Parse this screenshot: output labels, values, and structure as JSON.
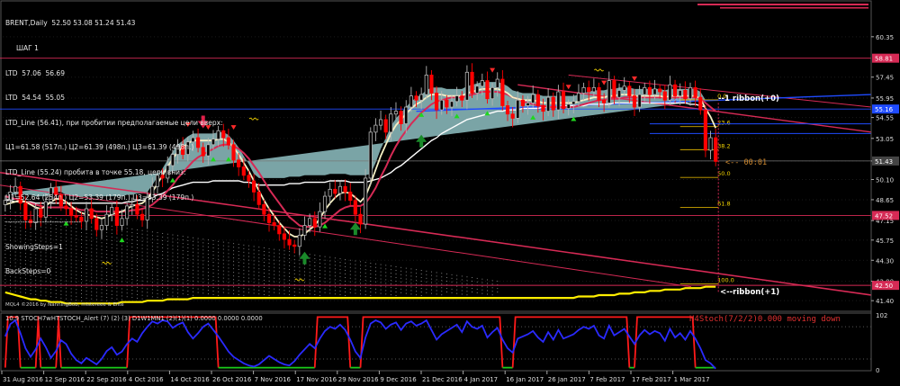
{
  "header": {
    "lines": [
      "BRENT,Daily  52.50 53.08 51.24 51.43",
      "ШАГ 1",
      "LTD  57.06  56.69",
      "LTD  54.54  55.05",
      "LTD_Line (56.41), при пробитии предполагаемые цели вверх:",
      "Ц1=61.58 (517п.) Ц2=61.39 (498п.) Ц3=61.39 (498п.)",
      "LTD_Line (55.24) пробита в точке 55.18, цели вниз:",
      "Ц1=52.64 (254п.) Ц2=53.39 (179п.) Ц3=53.39 (179п.)",
      "-------------------------------",
      "ShowingSteps=1",
      "BackSteps=0"
    ]
  },
  "copyright": "MQL4 ©2016 by NanningBob, mistereee & Elite",
  "ribbon_labels": [
    "--1 ribbon(+0)",
    "<--ribbon(+1)"
  ],
  "timer_label": "<-- 00:01",
  "fib_levels": [
    "0.0",
    "23.6",
    "38.2",
    "50.0",
    "61.8",
    "100.0"
  ],
  "lower_panel": {
    "title": "10.9 STOCH7wHTSTOCH_Alert (7) (2) (3) D1W1MN1 (2)(1)(1) 0.0000 0.0000 0.0000",
    "annotation": "H4Stoch(7/2/2)0.000 moving down",
    "y_ticks": [
      "102",
      "0"
    ]
  },
  "colors": {
    "background": "#000000",
    "bull_candle": "#b4b4b4",
    "bear_candle": "#ff0000",
    "cloud": "#8fc1c3",
    "yellow_line": "#ffee00",
    "red_line": "#d62a55",
    "cream_line": "#f6f0c4",
    "blue_line": "#1f4bff",
    "stoch_blue": "#2a2aff"
  },
  "chart_data": [
    {
      "type": "candlestick",
      "title": "BRENT,Daily",
      "ylim": [
        40.7,
        62.6
      ],
      "y_ticks": [
        "60.35",
        "57.45",
        "55.95",
        "54.55",
        "53.05",
        "51.43",
        "50.10",
        "48.65",
        "47.15",
        "45.75",
        "44.30",
        "42.80",
        "41.40"
      ],
      "price_tags": [
        {
          "value": "58.81",
          "color": "#d62a55"
        },
        {
          "value": "55.16",
          "color": "#1f4bff"
        },
        {
          "value": "51.43",
          "color": "#444444"
        },
        {
          "value": "47.52",
          "color": "#d62a55"
        },
        {
          "value": "42.50",
          "color": "#d62a55"
        }
      ],
      "x_tick_labels": [
        "31 Aug 2016",
        "12 Sep 2016",
        "22 Sep 2016",
        "4 Oct 2016",
        "14 Oct 2016",
        "26 Oct 2016",
        "7 Nov 2016",
        "17 Nov 2016",
        "29 Nov 2016",
        "9 Dec 2016",
        "21 Dec 2016",
        "4 Jan 2017",
        "16 Jan 2017",
        "26 Jan 2017",
        "7 Feb 2017",
        "17 Feb 2017",
        "1 Mar 2017"
      ],
      "closes": [
        48.6,
        49.2,
        49.6,
        48.4,
        47.2,
        47.0,
        48.0,
        47.4,
        48.5,
        49.5,
        49.0,
        48.2,
        48.0,
        47.5,
        47.4,
        47.1,
        48.0,
        47.3,
        46.5,
        46.8,
        47.6,
        48.1,
        46.8,
        47.3,
        48.2,
        48.3,
        47.6,
        47.2,
        48.8,
        49.6,
        50.4,
        50.2,
        51.1,
        51.9,
        52.5,
        51.9,
        52.8,
        53.1,
        52.4,
        51.8,
        52.6,
        53.0,
        53.6,
        53.1,
        52.6,
        51.5,
        51.0,
        50.4,
        50.0,
        49.2,
        48.3,
        47.6,
        47.0,
        46.8,
        46.2,
        45.8,
        45.4,
        45.3,
        46.1,
        46.8,
        47.3,
        46.7,
        47.8,
        48.9,
        49.4,
        49.1,
        49.6,
        49.2,
        48.6,
        47.6,
        46.9,
        50.2,
        53.5,
        54.0,
        54.4,
        53.5,
        54.8,
        55.0,
        54.1,
        55.3,
        56.1,
        55.8,
        56.2,
        57.6,
        56.3,
        55.1,
        55.8,
        55.3,
        55.7,
        56.1,
        55.8,
        57.8,
        56.3,
        56.8,
        57.2,
        55.9,
        56.7,
        57.3,
        55.4,
        54.8,
        54.5,
        55.8,
        55.4,
        55.6,
        56.2,
        55.4,
        55.0,
        56.0,
        55.1,
        56.4,
        55.2,
        55.5,
        55.7,
        56.3,
        56.7,
        56.4,
        56.7,
        55.8,
        55.6,
        57.2,
        56.0,
        56.5,
        56.8,
        56.1,
        55.3,
        56.2,
        56.7,
        56.2,
        56.6,
        56.4,
        55.8,
        56.9,
        56.1,
        56.5,
        55.9,
        56.7,
        56.0,
        55.1,
        52.2,
        53.1,
        51.4
      ],
      "series": [
        {
          "name": "",
          "color": "#f6f0c4",
          "values": [
            48.3,
            48.4,
            48.5,
            48.6,
            48.5,
            48.3,
            48.1,
            48.0,
            48.2,
            48.5,
            48.7,
            48.7,
            48.5,
            48.2,
            47.9,
            47.7,
            47.6,
            47.5,
            47.4,
            47.3,
            47.4,
            47.6,
            47.7,
            47.8,
            48.0,
            48.2,
            48.3,
            48.4,
            48.7,
            49.2,
            49.8,
            50.4,
            51.0,
            51.6,
            52.1,
            52.4,
            52.7,
            52.9,
            52.9,
            52.9,
            52.9,
            52.9,
            53.0,
            53.0,
            52.8,
            52.4,
            51.9,
            51.3,
            50.7,
            50.0,
            49.3,
            48.6,
            48.0,
            47.5,
            47.0,
            46.6,
            46.2,
            46.0,
            46.0,
            46.2,
            46.5,
            46.8,
            47.3,
            47.9,
            48.4,
            48.8,
            49.1,
            49.2,
            49.1,
            48.8,
            48.5,
            48.9,
            49.8,
            50.8,
            51.8,
            52.6,
            53.4,
            54.0,
            54.4,
            54.8,
            55.2,
            55.5,
            55.7,
            56.0,
            56.2,
            56.2,
            56.2,
            56.1,
            56.1,
            56.1,
            56.1,
            56.3,
            56.4,
            56.5,
            56.6,
            56.6,
            56.6,
            56.6,
            56.5,
            56.3,
            56.0,
            55.9,
            55.8,
            55.8,
            55.8,
            55.7,
            55.6,
            55.6,
            55.6,
            55.6,
            55.6,
            55.6,
            55.6,
            55.7,
            55.8,
            55.9,
            56.0,
            56.0,
            56.0,
            56.1,
            56.1,
            56.2,
            56.2,
            56.2,
            56.1,
            56.1,
            56.1,
            56.1,
            56.1,
            56.1,
            56.0,
            56.1,
            56.1,
            56.1,
            56.1,
            56.1,
            56.1,
            55.9,
            55.2,
            54.6,
            53.8
          ]
        },
        {
          "name": "",
          "color": "#d62a55",
          "values": [
            48.9,
            48.8,
            48.7,
            48.6,
            48.5,
            48.4,
            48.3,
            48.2,
            48.1,
            48.1,
            48.1,
            48.1,
            48.1,
            48.0,
            48.0,
            47.9,
            47.9,
            47.9,
            47.8,
            47.8,
            47.8,
            47.8,
            47.8,
            47.8,
            47.8,
            47.9,
            47.9,
            48.0,
            48.1,
            48.3,
            48.6,
            48.9,
            49.3,
            49.7,
            50.2,
            50.6,
            51.0,
            51.4,
            51.7,
            51.9,
            52.1,
            52.3,
            52.5,
            52.6,
            52.6,
            52.5,
            52.3,
            52.0,
            51.6,
            51.1,
            50.6,
            50.0,
            49.4,
            48.9,
            48.4,
            47.9,
            47.4,
            47.1,
            46.8,
            46.7,
            46.7,
            46.7,
            46.8,
            47.0,
            47.3,
            47.6,
            47.9,
            48.1,
            48.2,
            48.2,
            48.2,
            48.4,
            48.9,
            49.5,
            50.3,
            51.0,
            51.8,
            52.5,
            53.1,
            53.6,
            54.1,
            54.5,
            54.9,
            55.2,
            55.5,
            55.7,
            55.8,
            55.9,
            56.0,
            56.0,
            56.0,
            56.1,
            56.2,
            56.3,
            56.4,
            56.4,
            56.4,
            56.4,
            56.3,
            56.2,
            56.0,
            55.9,
            55.7,
            55.6,
            55.5,
            55.4,
            55.4,
            55.3,
            55.3,
            55.3,
            55.3,
            55.3,
            55.3,
            55.4,
            55.5,
            55.6,
            55.7,
            55.8,
            55.8,
            55.9,
            55.9,
            55.9,
            56.0,
            56.0,
            56.0,
            56.0,
            56.0,
            56.0,
            56.0,
            56.0,
            56.0,
            56.0,
            56.0,
            56.0,
            56.0,
            56.0,
            56.0,
            55.9,
            55.6,
            55.3,
            55.0
          ]
        },
        {
          "name": "",
          "color": "#8fc1c3",
          "values": [
            48.6,
            48.6,
            48.5,
            48.5,
            48.5,
            48.5,
            48.4,
            48.4,
            48.4,
            48.4,
            48.4,
            48.4,
            48.4,
            48.4,
            48.4,
            48.4,
            48.4,
            48.4,
            48.4,
            48.4,
            48.4,
            48.4,
            48.4,
            48.4,
            48.5,
            48.5,
            48.6,
            48.6,
            48.7,
            48.8,
            49.0,
            49.1,
            49.3,
            49.5,
            49.6,
            49.7,
            49.8,
            49.9,
            49.9,
            49.9,
            49.9,
            50.0,
            50.0,
            50.0,
            50.0,
            50.0,
            50.0,
            49.9,
            49.9,
            49.8,
            49.7,
            49.7,
            49.7,
            49.7,
            49.7,
            49.7,
            49.8,
            49.8,
            49.8,
            49.9,
            49.9,
            49.9,
            49.9,
            49.9,
            50.0,
            50.0,
            50.0,
            50.0,
            49.9,
            49.9,
            49.9,
            49.9,
            50.0,
            50.1,
            50.2,
            50.4,
            50.6,
            50.9,
            51.1,
            51.4,
            51.7,
            52.0,
            52.3,
            52.6,
            52.9,
            53.1,
            53.4,
            53.6,
            53.8,
            54.0,
            54.2,
            54.4,
            54.5,
            54.6,
            54.7,
            54.8,
            54.9,
            55.0,
            55.0,
            55.1,
            55.1,
            55.1,
            55.2,
            55.2,
            55.2,
            55.2,
            55.3,
            55.3,
            55.3,
            55.3,
            55.4,
            55.4,
            55.4,
            55.4,
            55.4,
            55.5,
            55.5,
            55.5,
            55.5,
            55.5,
            55.6,
            55.6,
            55.6,
            55.6,
            55.6,
            55.6,
            55.6,
            55.6,
            55.6,
            55.6,
            55.6,
            55.6,
            55.6,
            55.6,
            55.6,
            55.5,
            55.5,
            55.4,
            55.3
          ]
        },
        {
          "name": "",
          "color": "#ffee00",
          "values": [
            42.0,
            41.9,
            41.8,
            41.7,
            41.6,
            41.5,
            41.5,
            41.4,
            41.4,
            41.3,
            41.3,
            41.3,
            41.2,
            41.2,
            41.2,
            41.2,
            41.2,
            41.2,
            41.2,
            41.2,
            41.2,
            41.2,
            41.2,
            41.3,
            41.3,
            41.3,
            41.3,
            41.3,
            41.4,
            41.4,
            41.4,
            41.4,
            41.5,
            41.5,
            41.5,
            41.5,
            41.5,
            41.6,
            41.6,
            41.6,
            41.6,
            41.6,
            41.6,
            41.6,
            41.6,
            41.6,
            41.6,
            41.6,
            41.6,
            41.6,
            41.6,
            41.6,
            41.6,
            41.6,
            41.6,
            41.6,
            41.6,
            41.6,
            41.6,
            41.6,
            41.6,
            41.6,
            41.6,
            41.6,
            41.6,
            41.6,
            41.6,
            41.6,
            41.6,
            41.6,
            41.6,
            41.6,
            41.6,
            41.6,
            41.6,
            41.6,
            41.6,
            41.6,
            41.6,
            41.6,
            41.6,
            41.6,
            41.6,
            41.6,
            41.6,
            41.6,
            41.6,
            41.6,
            41.6,
            41.6,
            41.6,
            41.6,
            41.6,
            41.6,
            41.6,
            41.6,
            41.6,
            41.6,
            41.6,
            41.6,
            41.6,
            41.6,
            41.6,
            41.6,
            41.6,
            41.6,
            41.6,
            41.6,
            41.6,
            41.6,
            41.6,
            41.6,
            41.6,
            41.7,
            41.7,
            41.7,
            41.7,
            41.8,
            41.8,
            41.8,
            41.8,
            41.9,
            41.9,
            41.9,
            42.0,
            42.0,
            42.0,
            42.1,
            42.1,
            42.1,
            42.2,
            42.2,
            42.2,
            42.2,
            42.3,
            42.3,
            42.3,
            42.3,
            42.4,
            42.4,
            42.4
          ]
        }
      ]
    },
    {
      "type": "line",
      "title": "10.9 STOCH7wHTSTOCH_Alert (7) (2) (3) D1W1MN1 (2)(1)(1) 0.0000 0.0000 0.0000",
      "ylim": [
        0,
        102
      ],
      "series": [
        {
          "name": "",
          "color": "#2a2aff",
          "values": [
            62,
            85,
            92,
            68,
            40,
            24,
            38,
            58,
            42,
            22,
            35,
            55,
            48,
            30,
            18,
            12,
            22,
            16,
            10,
            20,
            35,
            42,
            28,
            34,
            48,
            58,
            52,
            68,
            80,
            90,
            86,
            92,
            90,
            78,
            84,
            88,
            70,
            58,
            68,
            80,
            86,
            74,
            62,
            48,
            34,
            24,
            18,
            12,
            8,
            6,
            10,
            18,
            26,
            20,
            14,
            10,
            8,
            16,
            28,
            38,
            48,
            40,
            58,
            72,
            80,
            76,
            84,
            74,
            56,
            34,
            22,
            60,
            86,
            92,
            88,
            76,
            84,
            88,
            74,
            86,
            90,
            82,
            86,
            92,
            74,
            56,
            66,
            72,
            78,
            84,
            70,
            90,
            80,
            76,
            82,
            60,
            70,
            78,
            56,
            40,
            32,
            58,
            62,
            66,
            72,
            60,
            52,
            70,
            56,
            74,
            58,
            62,
            66,
            74,
            80,
            76,
            82,
            64,
            58,
            82,
            64,
            70,
            76,
            62,
            48,
            64,
            74,
            66,
            72,
            68,
            54,
            76,
            60,
            68,
            56,
            72,
            58,
            40,
            18,
            12,
            2
          ]
        }
      ]
    }
  ]
}
